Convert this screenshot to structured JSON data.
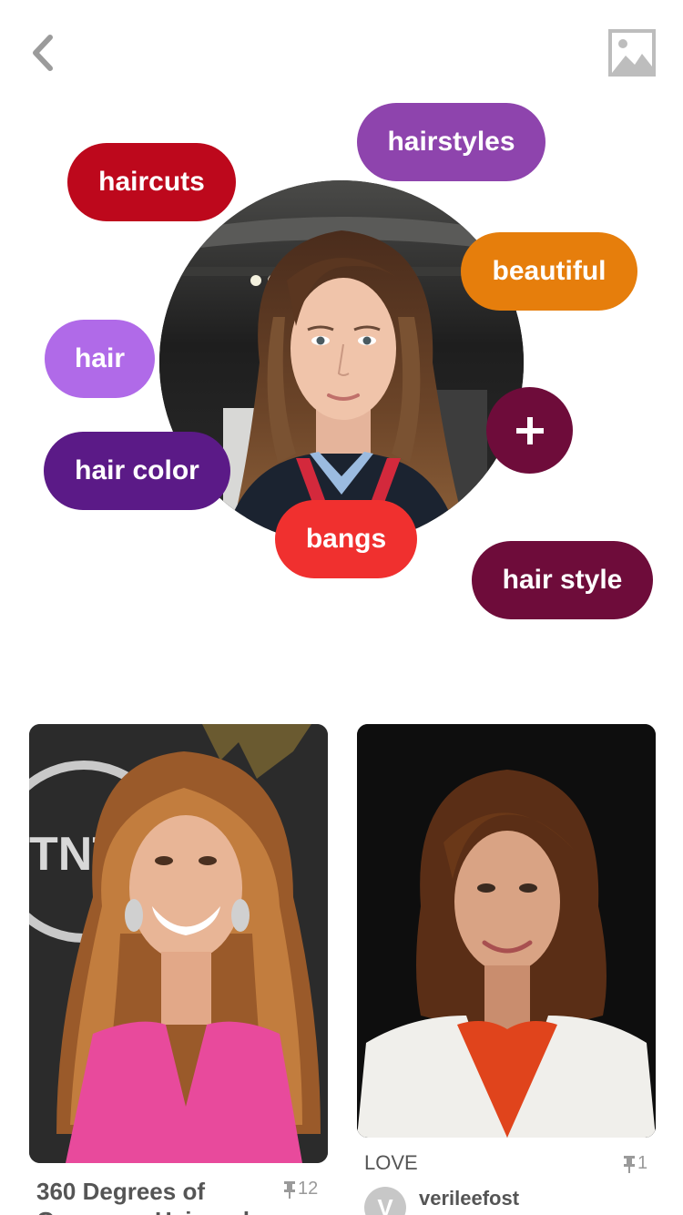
{
  "colors": {
    "haircuts": "#bd081c",
    "hairstyles": "#8e44ad",
    "beautiful": "#e67e0c",
    "hair": "#b06ae8",
    "hair_color": "#5b1a87",
    "bangs": "#f0302f",
    "hair_style": "#6e0c3a",
    "add": "#6e0c3a"
  },
  "tags": [
    {
      "label": "haircuts",
      "icon": ""
    },
    {
      "label": "hairstyles"
    },
    {
      "label": "beautiful"
    },
    {
      "label": "hair"
    },
    {
      "label": "hair color"
    },
    {
      "label": "bangs"
    },
    {
      "label": "hair style"
    }
  ],
  "icons": {
    "back": "chevron-left-icon",
    "image": "image-icon",
    "add": "plus-icon",
    "pin": "pin-icon"
  },
  "pins": [
    {
      "title_line1": "360 Degrees of",
      "title_line2": "Gorgeous Hair and",
      "count": "12"
    },
    {
      "description": "LOVE",
      "count": "1",
      "avatar_letter": "V",
      "username": "verileefost"
    }
  ]
}
